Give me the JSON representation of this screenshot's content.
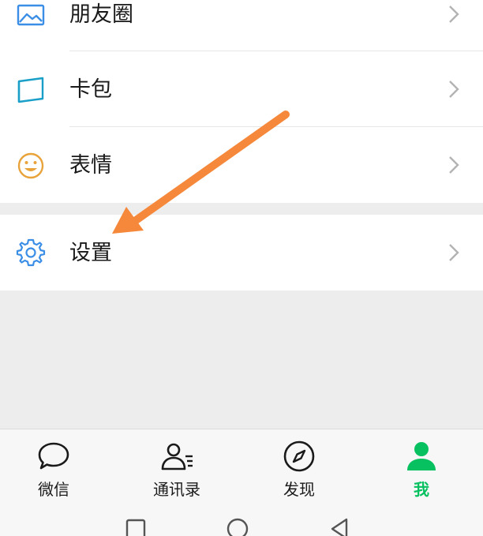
{
  "menu": {
    "items": [
      {
        "label": "朋友圈",
        "icon": "photo-icon"
      },
      {
        "label": "卡包",
        "icon": "card-wallet-icon"
      },
      {
        "label": "表情",
        "icon": "smiley-icon"
      },
      {
        "label": "设置",
        "icon": "gear-icon"
      }
    ]
  },
  "tabbar": {
    "tabs": [
      {
        "label": "微信",
        "icon": "chat-bubble-icon"
      },
      {
        "label": "通讯录",
        "icon": "contacts-icon"
      },
      {
        "label": "发现",
        "icon": "compass-icon"
      },
      {
        "label": "我",
        "icon": "person-icon",
        "active": true
      }
    ]
  },
  "colors": {
    "accent": "#07c160",
    "photo_icon": "#3a8ee6",
    "card_icon": "#1aa0c8",
    "smiley_icon": "#e8a33b",
    "gear_icon": "#3a8ee6",
    "annotation_arrow": "#f5883a",
    "background": "#ededed"
  },
  "navigation": {
    "buttons": [
      "recent-apps-icon",
      "home-icon",
      "back-icon"
    ]
  }
}
